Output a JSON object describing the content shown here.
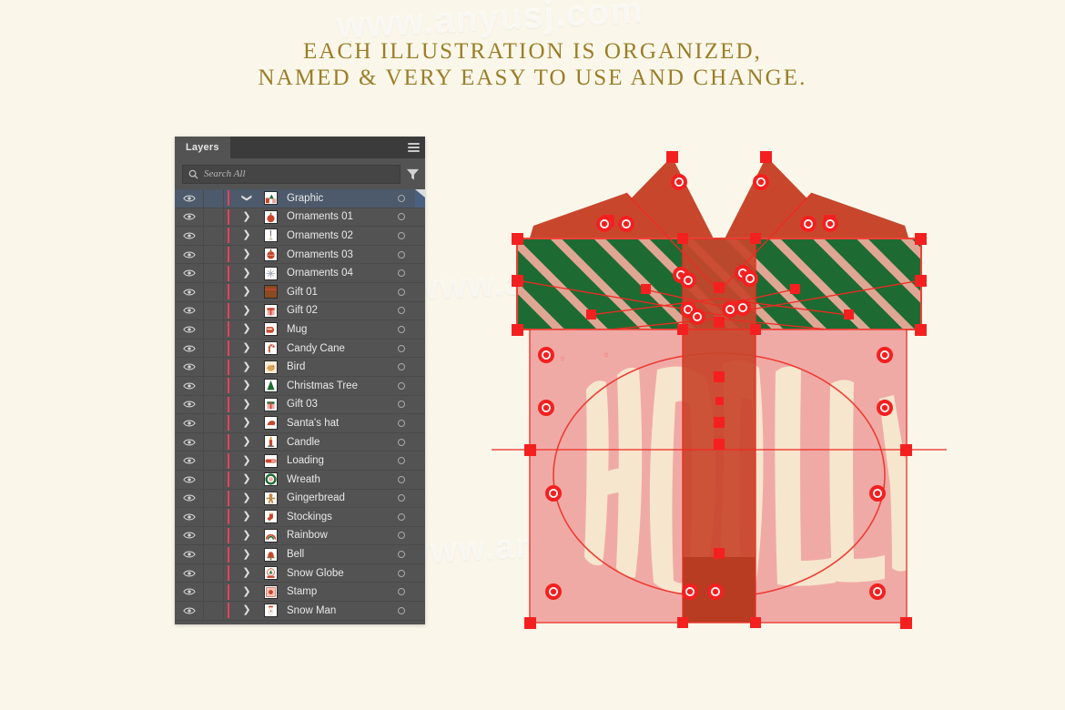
{
  "headline": {
    "line1": "EACH ILLUSTRATION IS ORGANIZED,",
    "line2": "NAMED & VERY EASY TO USE AND CHANGE.",
    "color": "#9b7d28"
  },
  "watermarks": {
    "top": "www.anyusj.com",
    "middle": "www.anyusj.com",
    "bottom": "www.anyusj.com"
  },
  "panel": {
    "tab_label": "Layers",
    "menu_icon": "hamburger-menu-icon",
    "search": {
      "placeholder": "Search All",
      "icon": "search-icon",
      "filter_icon": "filter-icon"
    },
    "colors": {
      "panel_bg": "#535353",
      "tabbar_bg": "#3b3b3b",
      "selected_row": "#4c5a6b",
      "layer_color_indicator": "#e8415a"
    },
    "layers": [
      {
        "name": "Graphic",
        "selected": true,
        "expanded": true,
        "visible": true,
        "thumb": "graphic-group-thumbnail"
      },
      {
        "name": "Ornaments 01",
        "selected": false,
        "expanded": false,
        "visible": true,
        "thumb": "ornament-bauble-thumbnail"
      },
      {
        "name": "Ornaments 02",
        "selected": false,
        "expanded": false,
        "visible": true,
        "thumb": "ornament-icicle-thumbnail"
      },
      {
        "name": "Ornaments 03",
        "selected": false,
        "expanded": false,
        "visible": true,
        "thumb": "ornament-ball-thumbnail"
      },
      {
        "name": "Ornaments 04",
        "selected": false,
        "expanded": false,
        "visible": true,
        "thumb": "ornament-snowflake-thumbnail"
      },
      {
        "name": "Gift 01",
        "selected": false,
        "expanded": false,
        "visible": true,
        "thumb": "gift-box-brown-thumbnail"
      },
      {
        "name": "Gift 02",
        "selected": false,
        "expanded": false,
        "visible": true,
        "thumb": "gift-box-red-thumbnail"
      },
      {
        "name": "Mug",
        "selected": false,
        "expanded": false,
        "visible": true,
        "thumb": "mug-thumbnail"
      },
      {
        "name": "Candy Cane",
        "selected": false,
        "expanded": false,
        "visible": true,
        "thumb": "candy-cane-thumbnail"
      },
      {
        "name": "Bird",
        "selected": false,
        "expanded": false,
        "visible": true,
        "thumb": "bird-thumbnail"
      },
      {
        "name": "Christmas Tree",
        "selected": false,
        "expanded": false,
        "visible": true,
        "thumb": "christmas-tree-thumbnail"
      },
      {
        "name": "Gift 03",
        "selected": false,
        "expanded": false,
        "visible": true,
        "thumb": "gift-box-green-thumbnail"
      },
      {
        "name": "Santa's hat",
        "selected": false,
        "expanded": false,
        "visible": true,
        "thumb": "santa-hat-thumbnail"
      },
      {
        "name": "Candle",
        "selected": false,
        "expanded": false,
        "visible": true,
        "thumb": "candle-thumbnail"
      },
      {
        "name": "Loading",
        "selected": false,
        "expanded": false,
        "visible": true,
        "thumb": "loading-bar-thumbnail"
      },
      {
        "name": "Wreath",
        "selected": false,
        "expanded": false,
        "visible": true,
        "thumb": "wreath-thumbnail"
      },
      {
        "name": "Gingerbread",
        "selected": false,
        "expanded": false,
        "visible": true,
        "thumb": "gingerbread-man-thumbnail"
      },
      {
        "name": "Stockings",
        "selected": false,
        "expanded": false,
        "visible": true,
        "thumb": "stocking-thumbnail"
      },
      {
        "name": "Rainbow",
        "selected": false,
        "expanded": false,
        "visible": true,
        "thumb": "rainbow-thumbnail"
      },
      {
        "name": "Bell",
        "selected": false,
        "expanded": false,
        "visible": true,
        "thumb": "bell-thumbnail"
      },
      {
        "name": "Snow Globe",
        "selected": false,
        "expanded": false,
        "visible": true,
        "thumb": "snow-globe-thumbnail"
      },
      {
        "name": "Stamp",
        "selected": false,
        "expanded": false,
        "visible": true,
        "thumb": "stamp-thumbnail"
      },
      {
        "name": "Snow Man",
        "selected": false,
        "expanded": false,
        "visible": true,
        "thumb": "snowman-thumbnail"
      }
    ]
  },
  "illustration": {
    "title": "HOLLY",
    "description": "gift-box-with-bow-vector-selection",
    "colors": {
      "lid_green": "#1d6b32",
      "lid_stripe": "#e0a694",
      "box_pink": "#f0aaa6",
      "ribbon_red": "#c8452b",
      "bow_red": "#c8472c",
      "text_cream": "#f4e3c8",
      "selection_red": "#f42020",
      "anchor_red": "#f42020"
    }
  }
}
